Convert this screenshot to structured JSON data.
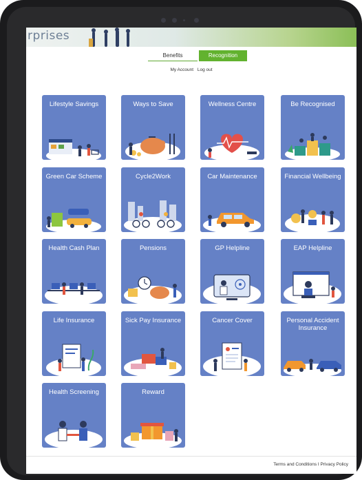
{
  "banner": {
    "brand_text": "rprises"
  },
  "nav": {
    "tabs": [
      {
        "label": "Benefits",
        "active": true
      },
      {
        "label": "Recognition",
        "active": false
      }
    ],
    "my_account": "My Account",
    "logout": "Log out"
  },
  "tiles": [
    {
      "label": "Lifestyle Savings",
      "icon": "shopping-icon"
    },
    {
      "label": "Ways to Save",
      "icon": "piggy-bank-icon"
    },
    {
      "label": "Wellness Centre",
      "icon": "heart-health-icon"
    },
    {
      "label": "Be Recognised",
      "icon": "podium-icon"
    },
    {
      "label": "Green Car Scheme",
      "icon": "green-car-icon"
    },
    {
      "label": "Cycle2Work",
      "icon": "bicycle-icon"
    },
    {
      "label": "Car Maintenance",
      "icon": "car-repair-icon"
    },
    {
      "label": "Financial Wellbeing",
      "icon": "finance-icon"
    },
    {
      "label": "Health Cash Plan",
      "icon": "office-health-icon"
    },
    {
      "label": "Pensions",
      "icon": "pension-icon"
    },
    {
      "label": "GP Helpline",
      "icon": "doctor-video-icon"
    },
    {
      "label": "EAP Helpline",
      "icon": "support-call-icon"
    },
    {
      "label": "Life Insurance",
      "icon": "family-insurance-icon"
    },
    {
      "label": "Sick Pay Insurance",
      "icon": "sick-pay-icon"
    },
    {
      "label": "Cancer Cover",
      "icon": "medical-report-icon"
    },
    {
      "label": "Personal Accident Insurance",
      "icon": "accident-car-icon"
    },
    {
      "label": "Health Screening",
      "icon": "screening-icon"
    },
    {
      "label": "Reward",
      "icon": "gift-icon"
    }
  ],
  "footer": {
    "terms": "Terms and Conditions",
    "separator": "I",
    "privacy": "Privacy Policy"
  },
  "colors": {
    "tile_bg": "#6581c6",
    "accent_green": "#62b22f"
  }
}
